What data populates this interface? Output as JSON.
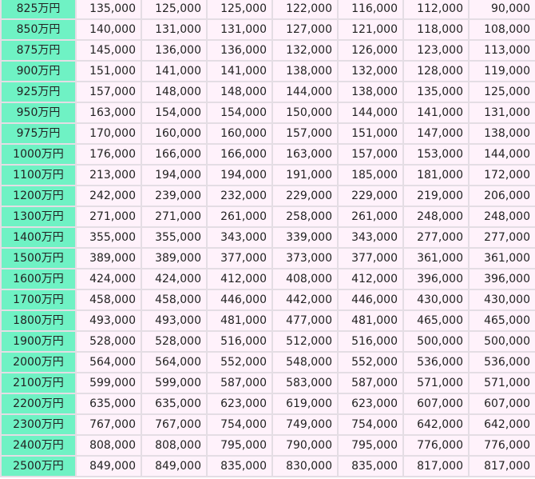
{
  "table": {
    "rows": [
      {
        "label": "825万円",
        "values": [
          "135,000",
          "125,000",
          "125,000",
          "122,000",
          "116,000",
          "112,000",
          "90,000"
        ]
      },
      {
        "label": "850万円",
        "values": [
          "140,000",
          "131,000",
          "131,000",
          "127,000",
          "121,000",
          "118,000",
          "108,000"
        ]
      },
      {
        "label": "875万円",
        "values": [
          "145,000",
          "136,000",
          "136,000",
          "132,000",
          "126,000",
          "123,000",
          "113,000"
        ]
      },
      {
        "label": "900万円",
        "values": [
          "151,000",
          "141,000",
          "141,000",
          "138,000",
          "132,000",
          "128,000",
          "119,000"
        ]
      },
      {
        "label": "925万円",
        "values": [
          "157,000",
          "148,000",
          "148,000",
          "144,000",
          "138,000",
          "135,000",
          "125,000"
        ]
      },
      {
        "label": "950万円",
        "values": [
          "163,000",
          "154,000",
          "154,000",
          "150,000",
          "144,000",
          "141,000",
          "131,000"
        ]
      },
      {
        "label": "975万円",
        "values": [
          "170,000",
          "160,000",
          "160,000",
          "157,000",
          "151,000",
          "147,000",
          "138,000"
        ]
      },
      {
        "label": "1000万円",
        "values": [
          "176,000",
          "166,000",
          "166,000",
          "163,000",
          "157,000",
          "153,000",
          "144,000"
        ]
      },
      {
        "label": "1100万円",
        "values": [
          "213,000",
          "194,000",
          "194,000",
          "191,000",
          "185,000",
          "181,000",
          "172,000"
        ]
      },
      {
        "label": "1200万円",
        "values": [
          "242,000",
          "239,000",
          "232,000",
          "229,000",
          "229,000",
          "219,000",
          "206,000"
        ]
      },
      {
        "label": "1300万円",
        "values": [
          "271,000",
          "271,000",
          "261,000",
          "258,000",
          "261,000",
          "248,000",
          "248,000"
        ]
      },
      {
        "label": "1400万円",
        "values": [
          "355,000",
          "355,000",
          "343,000",
          "339,000",
          "343,000",
          "277,000",
          "277,000"
        ]
      },
      {
        "label": "1500万円",
        "values": [
          "389,000",
          "389,000",
          "377,000",
          "373,000",
          "377,000",
          "361,000",
          "361,000"
        ]
      },
      {
        "label": "1600万円",
        "values": [
          "424,000",
          "424,000",
          "412,000",
          "408,000",
          "412,000",
          "396,000",
          "396,000"
        ]
      },
      {
        "label": "1700万円",
        "values": [
          "458,000",
          "458,000",
          "446,000",
          "442,000",
          "446,000",
          "430,000",
          "430,000"
        ]
      },
      {
        "label": "1800万円",
        "values": [
          "493,000",
          "493,000",
          "481,000",
          "477,000",
          "481,000",
          "465,000",
          "465,000"
        ]
      },
      {
        "label": "1900万円",
        "values": [
          "528,000",
          "528,000",
          "516,000",
          "512,000",
          "516,000",
          "500,000",
          "500,000"
        ]
      },
      {
        "label": "2000万円",
        "values": [
          "564,000",
          "564,000",
          "552,000",
          "548,000",
          "552,000",
          "536,000",
          "536,000"
        ]
      },
      {
        "label": "2100万円",
        "values": [
          "599,000",
          "599,000",
          "587,000",
          "583,000",
          "587,000",
          "571,000",
          "571,000"
        ]
      },
      {
        "label": "2200万円",
        "values": [
          "635,000",
          "635,000",
          "623,000",
          "619,000",
          "623,000",
          "607,000",
          "607,000"
        ]
      },
      {
        "label": "2300万円",
        "values": [
          "767,000",
          "767,000",
          "754,000",
          "749,000",
          "754,000",
          "642,000",
          "642,000"
        ]
      },
      {
        "label": "2400万円",
        "values": [
          "808,000",
          "808,000",
          "795,000",
          "790,000",
          "795,000",
          "776,000",
          "776,000"
        ]
      },
      {
        "label": "2500万円",
        "values": [
          "849,000",
          "849,000",
          "835,000",
          "830,000",
          "835,000",
          "817,000",
          "817,000"
        ]
      }
    ]
  }
}
